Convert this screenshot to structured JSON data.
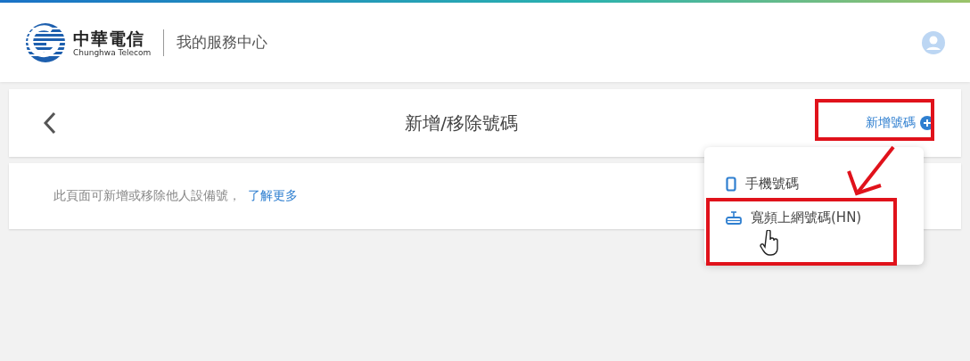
{
  "header": {
    "brand_name": "中華電信",
    "brand_subtitle": "Chunghwa Telecom",
    "section_title": "我的服務中心"
  },
  "page": {
    "title": "新增/移除號碼",
    "add_link": "新增號碼"
  },
  "info": {
    "text": "此頁面可新增或移除他人設備號，",
    "link": "了解更多"
  },
  "dropdown": {
    "items": [
      {
        "kind": "phone",
        "label": "手機號碼"
      },
      {
        "kind": "router",
        "label": "寬頻上網號碼(HN)"
      }
    ]
  }
}
